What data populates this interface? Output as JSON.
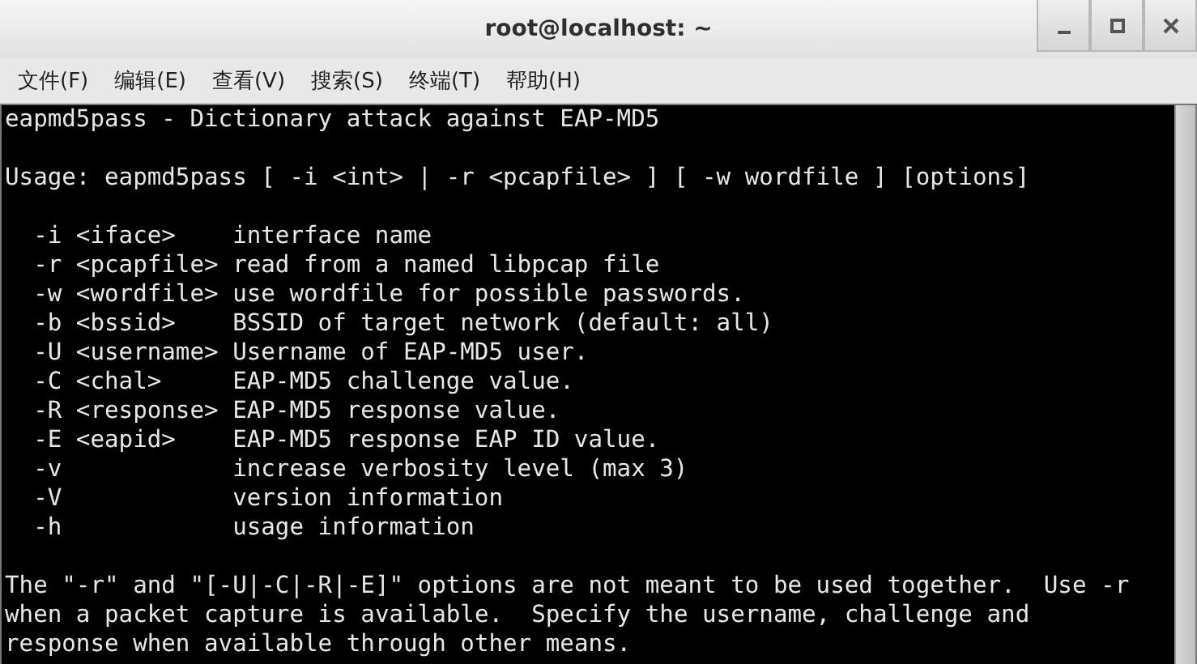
{
  "window": {
    "title": "root@localhost: ~"
  },
  "menu": [
    "文件(F)",
    "编辑(E)",
    "查看(V)",
    "搜索(S)",
    "终端(T)",
    "帮助(H)"
  ],
  "terminal": {
    "heading": "eapmd5pass - Dictionary attack against EAP-MD5",
    "usage": "Usage: eapmd5pass [ -i <int> | -r <pcapfile> ] [ -w wordfile ] [options]",
    "options": [
      {
        "flag": "-i <iface>",
        "description": "interface name"
      },
      {
        "flag": "-r <pcapfile>",
        "description": "read from a named libpcap file"
      },
      {
        "flag": "-w <wordfile>",
        "description": "use wordfile for possible passwords."
      },
      {
        "flag": "-b <bssid>",
        "description": "BSSID of target network (default: all)"
      },
      {
        "flag": "-U <username>",
        "description": "Username of EAP-MD5 user."
      },
      {
        "flag": "-C <chal>",
        "description": "EAP-MD5 challenge value."
      },
      {
        "flag": "-R <response>",
        "description": "EAP-MD5 response value."
      },
      {
        "flag": "-E <eapid>",
        "description": "EAP-MD5 response EAP ID value."
      },
      {
        "flag": "-v",
        "description": "increase verbosity level (max 3)"
      },
      {
        "flag": "-V",
        "description": "version information"
      },
      {
        "flag": "-h",
        "description": "usage information"
      }
    ],
    "note_lines": [
      "The \"-r\" and \"[-U|-C|-R|-E]\" options are not meant to be used together.  Use -r",
      "when a packet capture is available.  Specify the username, challenge and",
      "response when available through other means."
    ]
  }
}
